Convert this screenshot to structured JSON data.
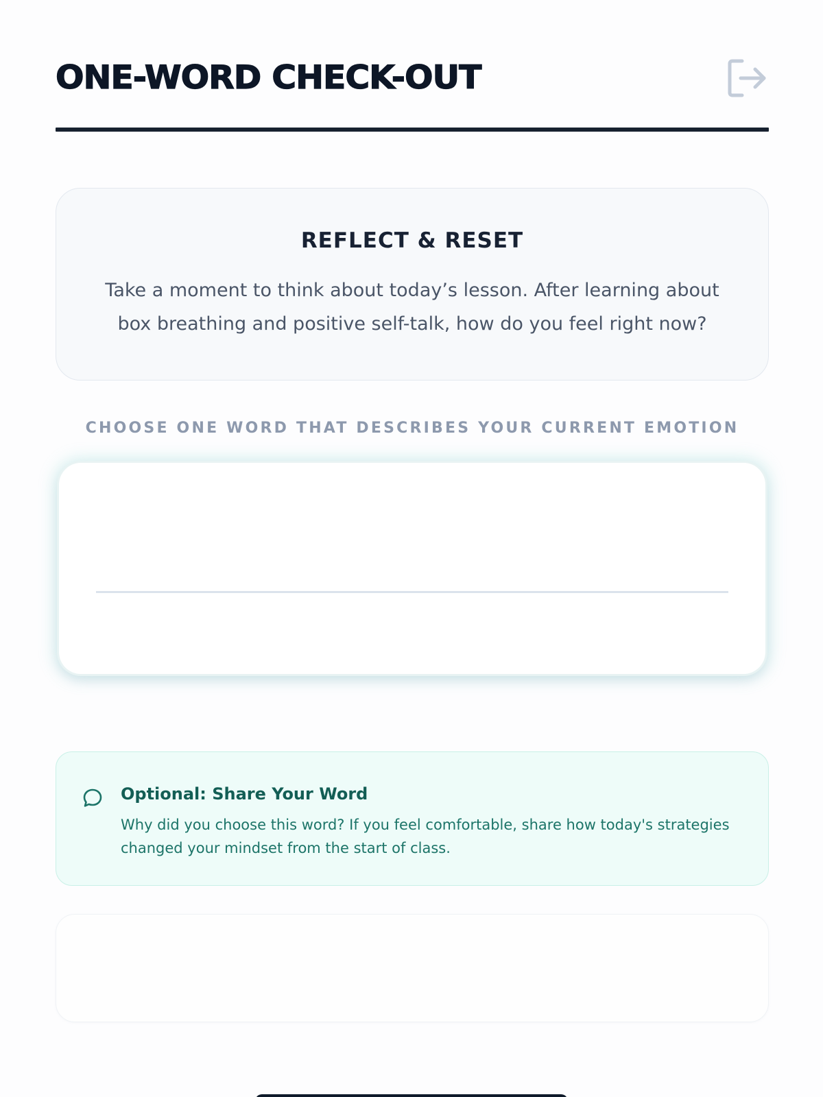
{
  "header": {
    "title": "ONE-WORD CHECK-OUT",
    "exit_icon": "log-out-icon"
  },
  "reflect": {
    "title": "REFLECT & RESET",
    "body": "Take a moment to think about today’s lesson. After learning about box breathing and positive self-talk, how do you feel right now?"
  },
  "prompt": {
    "label": "CHOOSE ONE WORD THAT DESCRIBES YOUR CURRENT EMOTION"
  },
  "word_input": {
    "value": "",
    "placeholder": ""
  },
  "share": {
    "icon": "chat-bubble-icon",
    "title": "Optional: Share Your Word",
    "text": "Why did you choose this word? If you feel comfortable, share how today's strategies changed your mindset from the start of class."
  },
  "share_input": {
    "value": "",
    "placeholder": ""
  },
  "colors": {
    "title": "#0d1626",
    "muted_label": "#8d99ad",
    "teal_dark": "#135e55",
    "teal_bg": "#eefcf9",
    "icon_gray": "#c3ccd9"
  }
}
